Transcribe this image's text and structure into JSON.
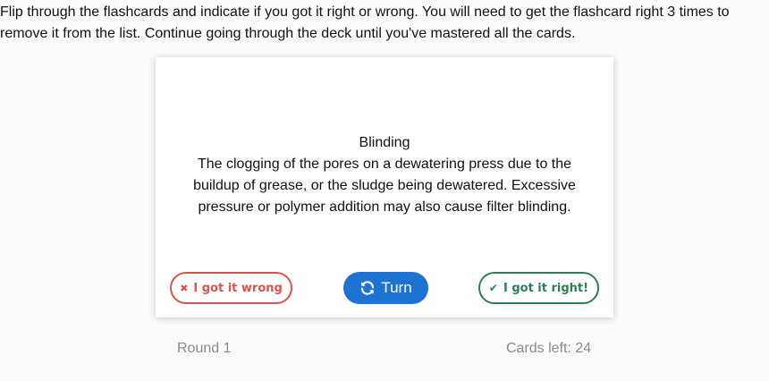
{
  "instructions": "Flip through the flashcards and indicate if you got it right or wrong. You will need to get the flashcard right 3 times to remove it from the list. Continue going through the deck until you've mastered all the cards.",
  "card": {
    "term": "Blinding",
    "definition": "The clogging of the pores on a dewatering press due to the buildup of grease, or the sludge being dewatered. Excessive pressure or polymer addition may also cause filter blinding."
  },
  "buttons": {
    "wrong_label": "I got it wrong",
    "wrong_icon": "times-icon",
    "turn_label": "Turn",
    "turn_icon": "refresh-icon",
    "right_label": "I got it right!",
    "right_icon": "check-icon"
  },
  "footer": {
    "round": "Round 1",
    "cards_left": "Cards left: 24"
  },
  "colors": {
    "wrong": "#d9534f",
    "turn": "#1e73d2",
    "right": "#2e7d55",
    "muted": "#8a8a8a"
  }
}
